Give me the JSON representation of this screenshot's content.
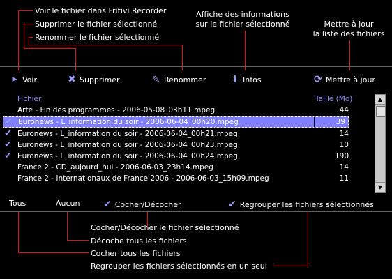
{
  "annotations_top": {
    "voir": "Voir le fichier dans Fritivi Recorder",
    "supprimer": "Supprimer le fichier sélectionné",
    "renommer": "Renommer le fichier sélectionné",
    "infos_1": "Affiche des informations",
    "infos_2": "sur le fichier sélectionné",
    "maj_1": "Mettre à jour",
    "maj_2": "la liste des fichiers"
  },
  "toolbar": {
    "voir": "Voir",
    "supprimer": "Supprimer",
    "renommer": "Renommer",
    "infos": "Infos",
    "maj": "Mettre à jour"
  },
  "list": {
    "col_file": "Fichier",
    "col_size": "Taille (Mo)",
    "rows": [
      {
        "name": "Arte - Fin des programmes - 2006-05-08_03h11.mpeg",
        "size": "44",
        "checked": false,
        "selected": false
      },
      {
        "name": "Euronews - L_information du soir - 2006-06-04_00h20.mpeg",
        "size": "39",
        "checked": true,
        "selected": true
      },
      {
        "name": "Euronews - L_information du soir - 2006-06-04_00h21.mpeg",
        "size": "14",
        "checked": true,
        "selected": false
      },
      {
        "name": "Euronews - L_information du soir - 2006-06-04_00h23.mpeg",
        "size": "10",
        "checked": true,
        "selected": false
      },
      {
        "name": "Euronews - L_information du soir - 2006-06-04_00h24.mpeg",
        "size": "190",
        "checked": true,
        "selected": false
      },
      {
        "name": "France 2 - CD_aujourd_hui - 2006-06-03_23h14.mpeg",
        "size": "14",
        "checked": false,
        "selected": false
      },
      {
        "name": "France 2 - Internationaux de France 2006 - 2006-06-03_15h09.mpeg",
        "size": "11",
        "checked": false,
        "selected": false
      }
    ]
  },
  "bottom": {
    "tous": "Tous",
    "aucun": "Aucun",
    "cocher": "Cocher/Décocher",
    "regrouper": "Regrouper les fichiers sélectionnés"
  },
  "annotations_bottom": {
    "cocher": "Cocher/Décocher le fichier sélectionné",
    "aucun": "Décoche tous les fichiers",
    "tous": "Cocher tous les fichiers",
    "regrouper": "Regrouper les fichiers sélectionnés en un seul"
  },
  "colors": {
    "accent": "#7f7fff",
    "annotation_line": "#d8141c",
    "header_text": "#8a8ef0"
  }
}
